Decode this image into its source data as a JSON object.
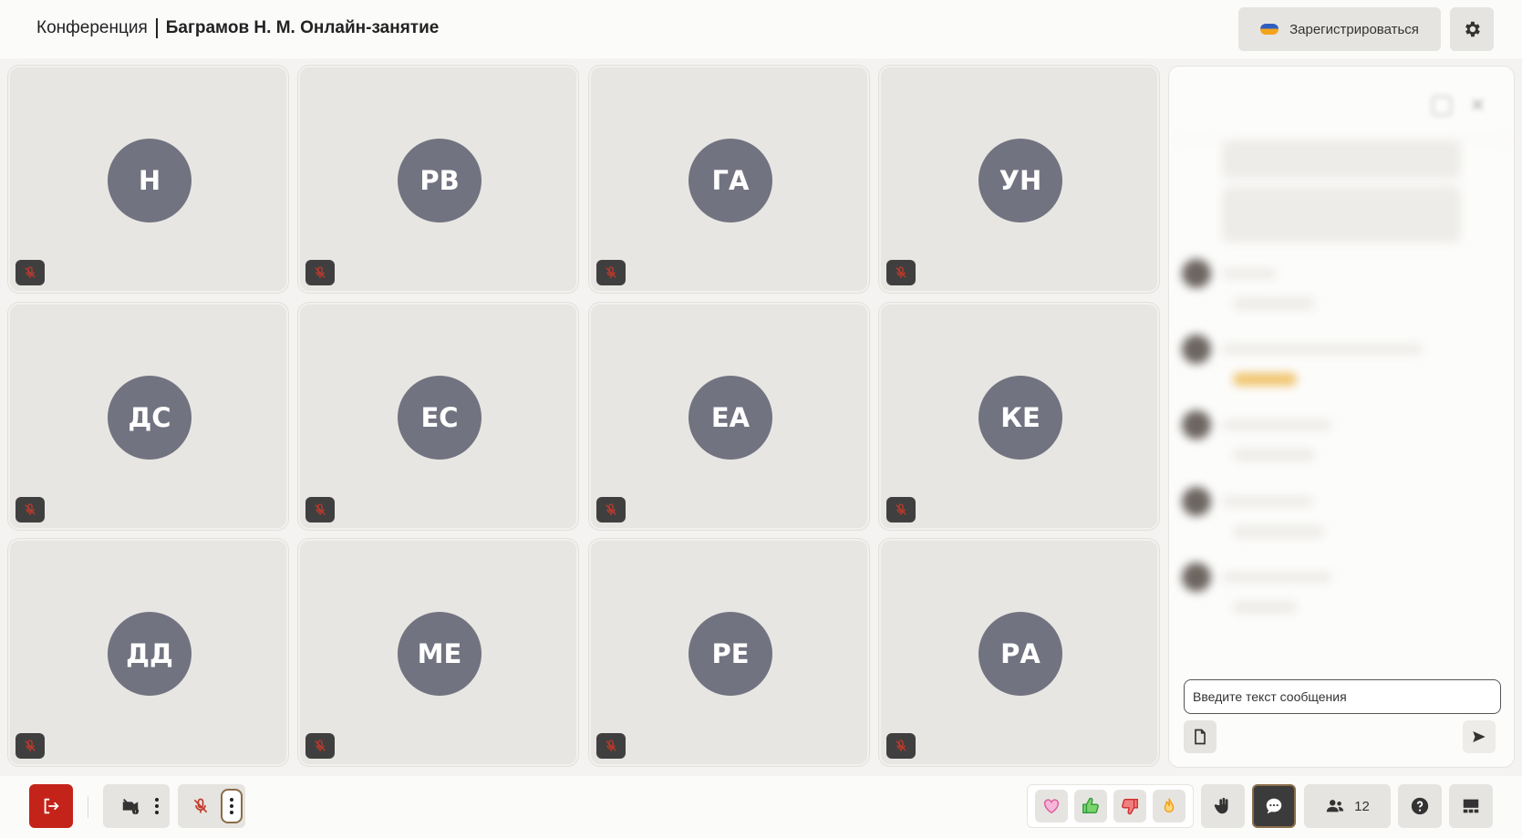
{
  "header": {
    "conference_label": "Конференция",
    "meeting_title": "Баграмов Н. М. Онлайн-занятие",
    "register_label": "Зарегистрироваться"
  },
  "participants": [
    {
      "initials": "Н"
    },
    {
      "initials": "РВ"
    },
    {
      "initials": "ГА"
    },
    {
      "initials": "УН"
    },
    {
      "initials": "ДС"
    },
    {
      "initials": "ЕС"
    },
    {
      "initials": "ЕА"
    },
    {
      "initials": "КЕ"
    },
    {
      "initials": "ДД"
    },
    {
      "initials": "МЕ"
    },
    {
      "initials": "РЕ"
    },
    {
      "initials": "РА"
    }
  ],
  "chat": {
    "input_placeholder": "Введите текст сообщения"
  },
  "bottombar": {
    "participants_count": "12"
  },
  "colors": {
    "avatar_bg": "#727381",
    "leave_red": "#c42319",
    "muted_mic_red": "#c0392b",
    "heart_pink": "#d65a9a",
    "like_green": "#2e9c3a",
    "dislike_red": "#d12b2b",
    "fire_orange": "#f39c12"
  },
  "icons": {
    "tile_status": "mic-muted-icon",
    "register": "register-logo-icon",
    "settings": "gear-icon"
  }
}
